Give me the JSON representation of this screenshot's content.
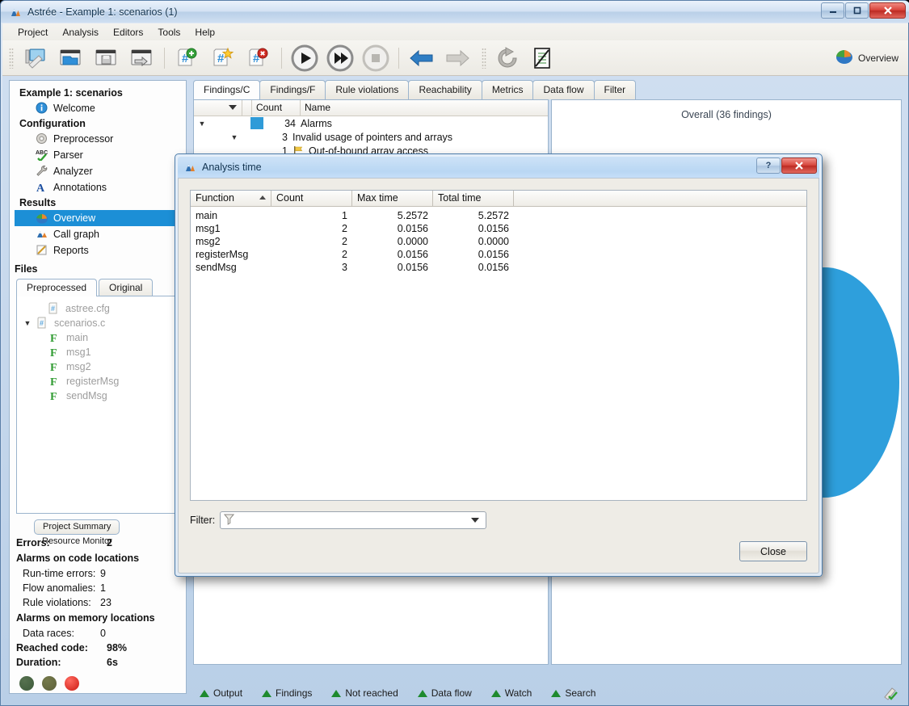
{
  "window": {
    "title": "Astrée - Example 1: scenarios (1)",
    "icon": "astree-mountain-icon",
    "controls": {
      "minimize": "—",
      "maximize": "❐",
      "close": "✕"
    }
  },
  "menubar": {
    "items": [
      "Project",
      "Analysis",
      "Editors",
      "Tools",
      "Help"
    ]
  },
  "toolbar": {
    "buttons": [
      {
        "name": "new-project-icon",
        "glyph": "monitor-pencil"
      },
      {
        "name": "open-project-icon",
        "glyph": "folder-open"
      },
      {
        "name": "save-project-icon",
        "glyph": "floppy-save"
      },
      {
        "name": "export-project-icon",
        "glyph": "window-arrow"
      },
      {
        "name": "add-preprocessed-file-icon",
        "glyph": "hash-plus"
      },
      {
        "name": "new-preprocessed-file-icon",
        "glyph": "hash-star"
      },
      {
        "name": "remove-preprocessed-file-icon",
        "glyph": "hash-delete"
      },
      {
        "name": "run-analysis-icon",
        "glyph": "play"
      },
      {
        "name": "run-fast-icon",
        "glyph": "fast-forward"
      },
      {
        "name": "stop-analysis-icon",
        "glyph": "stop"
      },
      {
        "name": "back-icon",
        "glyph": "arrow-left"
      },
      {
        "name": "forward-icon",
        "glyph": "arrow-right"
      },
      {
        "name": "refresh-icon",
        "glyph": "refresh"
      },
      {
        "name": "report-icon",
        "glyph": "clipboard-pen"
      }
    ],
    "overview_label": "Overview"
  },
  "sidebar": {
    "groups": [
      {
        "header": "Example 1: scenarios",
        "items": [
          {
            "label": "Welcome",
            "icon": "info-icon",
            "selected": false
          }
        ]
      },
      {
        "header": "Configuration",
        "items": [
          {
            "label": "Preprocessor",
            "icon": "gear-icon",
            "selected": false
          },
          {
            "label": "Parser",
            "icon": "abc-check-icon",
            "selected": false
          },
          {
            "label": "Analyzer",
            "icon": "wrench-icon",
            "selected": false
          },
          {
            "label": "Annotations",
            "icon": "letter-a-icon",
            "selected": false
          }
        ]
      },
      {
        "header": "Results",
        "items": [
          {
            "label": "Overview",
            "icon": "pie-chart-icon",
            "selected": true
          },
          {
            "label": "Call graph",
            "icon": "mountain-icon",
            "selected": false
          },
          {
            "label": "Reports",
            "icon": "report-page-icon",
            "selected": false
          }
        ]
      }
    ],
    "files_header": "Files",
    "file_tabs": [
      {
        "label": "Preprocessed",
        "active": true
      },
      {
        "label": "Original",
        "active": false
      }
    ],
    "file_tree": [
      {
        "label": "astree.cfg",
        "icon": "hash-file-icon",
        "indent": 1,
        "expander": ""
      },
      {
        "label": "scenarios.c",
        "icon": "hash-file-icon",
        "indent": 1,
        "expander": "▼"
      },
      {
        "label": "main",
        "icon": "function-icon",
        "indent": 2,
        "expander": ""
      },
      {
        "label": "msg1",
        "icon": "function-icon",
        "indent": 2,
        "expander": ""
      },
      {
        "label": "msg2",
        "icon": "function-icon",
        "indent": 2,
        "expander": ""
      },
      {
        "label": "registerMsg",
        "icon": "function-icon",
        "indent": 2,
        "expander": ""
      },
      {
        "label": "sendMsg",
        "icon": "function-icon",
        "indent": 2,
        "expander": ""
      }
    ],
    "summary_tabs": [
      {
        "label": "Project Summary",
        "active": true
      },
      {
        "label": "Resource Monitor",
        "active": false
      }
    ],
    "summary_rows": [
      {
        "label": "Errors:",
        "value": "2",
        "style": "bold"
      },
      {
        "label": "Alarms on code locations",
        "value": "",
        "style": "head"
      },
      {
        "label": "Run-time errors:",
        "value": "9",
        "style": "indent"
      },
      {
        "label": "Flow anomalies:",
        "value": "1",
        "style": "indent"
      },
      {
        "label": "Rule violations:",
        "value": "23",
        "style": "indent"
      },
      {
        "label": "Alarms on memory locations",
        "value": "",
        "style": "head"
      },
      {
        "label": "Data races:",
        "value": "0",
        "style": "indent"
      },
      {
        "label": "Reached code:",
        "value": "98%",
        "style": "bold"
      },
      {
        "label": "Duration:",
        "value": "6s",
        "style": "bold"
      }
    ],
    "status_lights": [
      "#3d5a3a",
      "#5d603a",
      "#e02323"
    ]
  },
  "content": {
    "tabs": [
      {
        "label": "Findings/C",
        "active": true
      },
      {
        "label": "Findings/F",
        "active": false
      },
      {
        "label": "Rule violations",
        "active": false
      },
      {
        "label": "Reachability",
        "active": false
      },
      {
        "label": "Metrics",
        "active": false
      },
      {
        "label": "Data flow",
        "active": false
      },
      {
        "label": "Filter",
        "active": false
      }
    ],
    "findings_table": {
      "columns": [
        "",
        "",
        "Count",
        "Name"
      ],
      "rows": [
        {
          "expander": "▼",
          "marker": true,
          "count": "34",
          "name": "Alarms",
          "indent": 0,
          "flag": false
        },
        {
          "expander": "▼",
          "marker": false,
          "count": "3",
          "name": "Invalid usage of pointers and arrays",
          "indent": 1,
          "flag": false
        },
        {
          "expander": "",
          "marker": false,
          "count": "1",
          "name": "Out-of-bound array access",
          "indent": 2,
          "flag": true
        }
      ]
    },
    "overview": {
      "title": "Overall (36 findings)",
      "pie_color": "#2e9fdc"
    }
  },
  "bottom_bar": {
    "items": [
      "Output",
      "Findings",
      "Not reached",
      "Data flow",
      "Watch",
      "Search"
    ],
    "right_icon": "pencil-check-icon"
  },
  "dialog": {
    "title": "Analysis time",
    "icon": "astree-mountain-icon",
    "help_label": "?",
    "close_label": "✕",
    "table": {
      "columns": [
        "Function",
        "Count",
        "Max time",
        "Total time",
        ""
      ],
      "sort_column": "Function",
      "sort_direction": "asc",
      "rows": [
        {
          "function": "main",
          "count": "1",
          "max_time": "5.2572",
          "total_time": "5.2572"
        },
        {
          "function": "msg1",
          "count": "2",
          "max_time": "0.0156",
          "total_time": "0.0156"
        },
        {
          "function": "msg2",
          "count": "2",
          "max_time": "0.0000",
          "total_time": "0.0000"
        },
        {
          "function": "registerMsg",
          "count": "2",
          "max_time": "0.0156",
          "total_time": "0.0156"
        },
        {
          "function": "sendMsg",
          "count": "3",
          "max_time": "0.0156",
          "total_time": "0.0156"
        }
      ]
    },
    "filter": {
      "label": "Filter:",
      "value": "",
      "placeholder": ""
    },
    "close_button": "Close"
  }
}
